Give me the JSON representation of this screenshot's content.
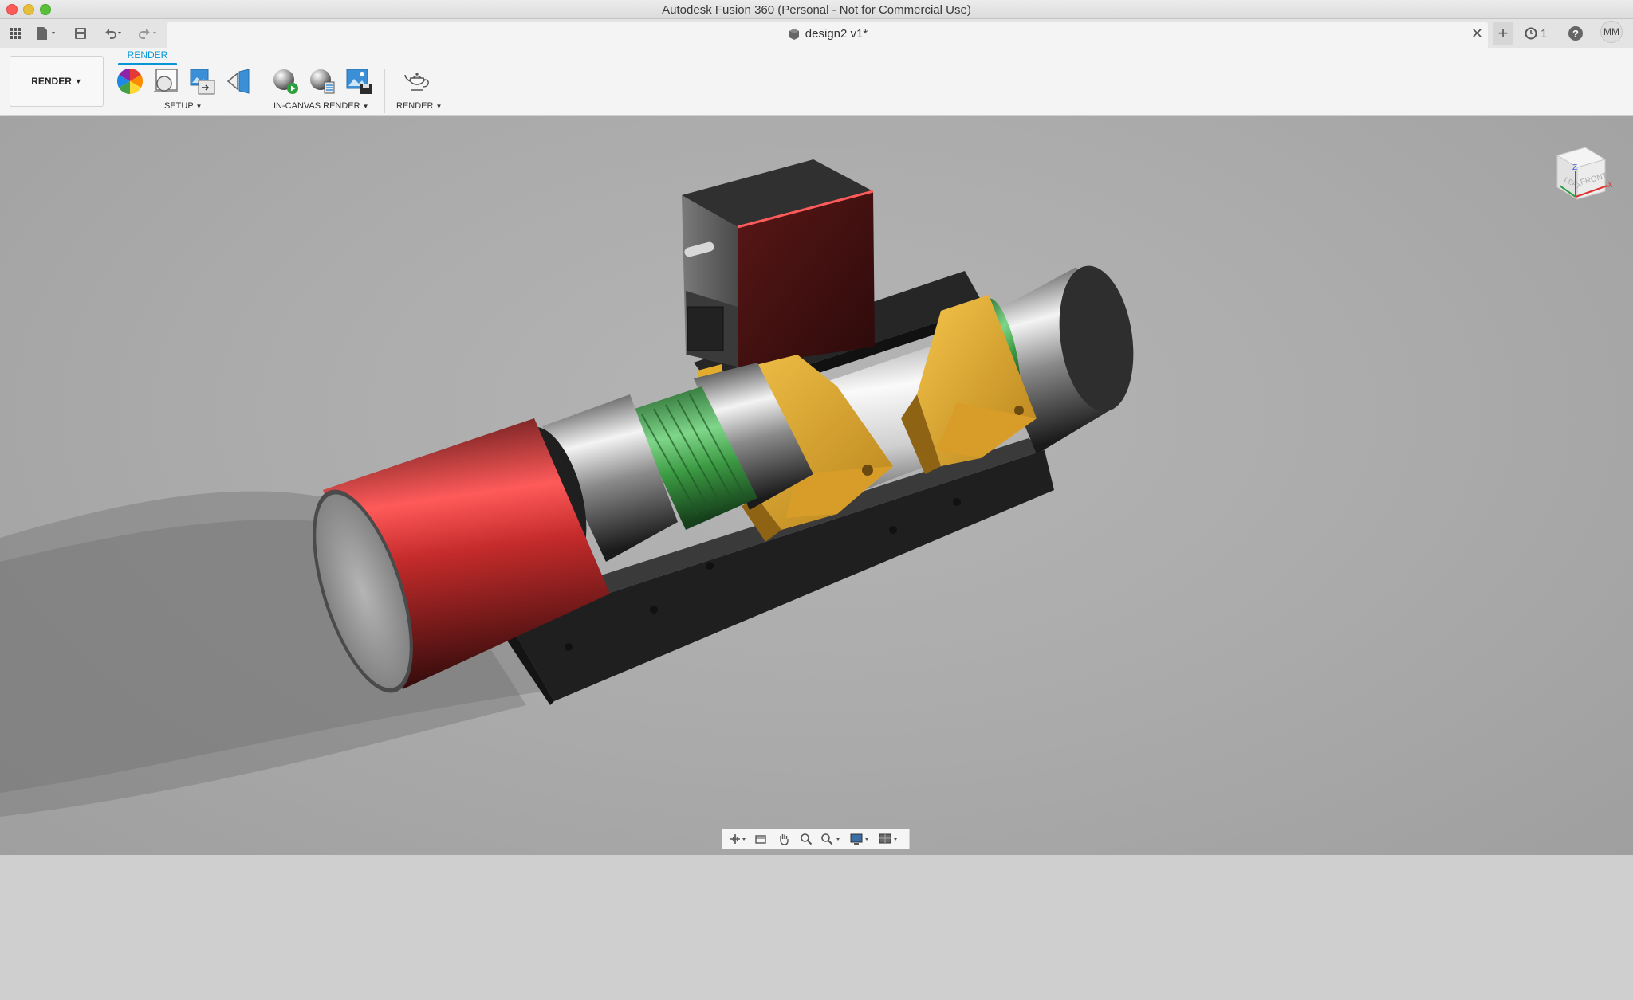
{
  "window": {
    "title": "Autodesk Fusion 360 (Personal - Not for Commercial Use)"
  },
  "document_tab": {
    "label": "design2 v1*",
    "close_glyph": "✕"
  },
  "quick_access": {
    "icons": [
      "app-grid-icon",
      "file-icon",
      "save-icon",
      "undo-icon",
      "redo-icon"
    ]
  },
  "right_controls": {
    "add_glyph": "+",
    "job_count": "1",
    "help_glyph": "?",
    "user_initials": "MM"
  },
  "ribbon": {
    "workspace_label": "RENDER",
    "active_tab": "RENDER",
    "groups": [
      {
        "label": "SETUP"
      },
      {
        "label": "IN-CANVAS RENDER"
      },
      {
        "label": "RENDER"
      }
    ]
  },
  "colors": {
    "accent": "#0696d7",
    "red_part": "#c52b2b",
    "yellow_part": "#e3ac2c",
    "green_part": "#3c9a43",
    "base_plate": "#2a2a2a"
  },
  "viewcube": {
    "front_label": "FRONT",
    "left_label": "LEFT",
    "axis_z": "Z",
    "axis_x": "X"
  }
}
